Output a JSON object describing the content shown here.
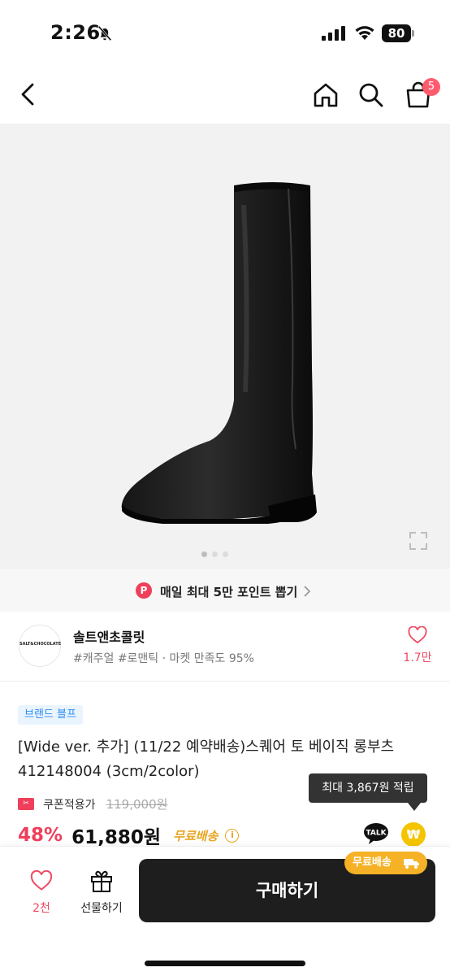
{
  "status_bar": {
    "time": "2:26",
    "battery_level": "80",
    "silent_icon": "bell-slash-icon",
    "signal_icon": "cellular-signal-icon",
    "wifi_icon": "wifi-icon"
  },
  "header": {
    "back_icon": "chevron-left-icon",
    "home_icon": "home-icon",
    "search_icon": "search-icon",
    "cart_icon": "shopping-bag-icon",
    "cart_count": "5"
  },
  "product_image": {
    "subject": "black knee-high square-toe boot",
    "slide_count": 3,
    "active_slide": 1,
    "expand_icon": "expand-icon"
  },
  "points_banner": {
    "icon_letter": "P",
    "text": "매일 최대 5만 포인트 뽑기"
  },
  "brand": {
    "logo_text": "SALT&CHOCOLATE",
    "name": "솔트앤초콜릿",
    "tags": "#캐주얼 #로맨틱 · 마켓 만족도 95%",
    "like_count": "1.7만"
  },
  "product": {
    "brand_tag": "브랜드 블프",
    "title": "[Wide ver. 추가] (11/22 예약배송)스퀘어 토 베이직 롱부츠 412148004 (3cm/2color)",
    "coupon_label": "쿠폰적용가",
    "original_price": "119,000원",
    "discount": "48%",
    "sale_price": "61,880원",
    "free_shipping": "무료배송",
    "points_tooltip": "최대 3,867원 적립",
    "talk_label": "TALK",
    "won_symbol": "₩"
  },
  "bottom_bar": {
    "like_count": "2천",
    "gift_label": "선물하기",
    "buy_label": "구매하기",
    "free_ship_pill": "무료배송"
  },
  "colors": {
    "accent_pink": "#ef3f5b",
    "free_ship_yellow": "#f5b226",
    "brand_tag_blue": "#2a8cf4",
    "buy_button": "#1e1e1e"
  }
}
